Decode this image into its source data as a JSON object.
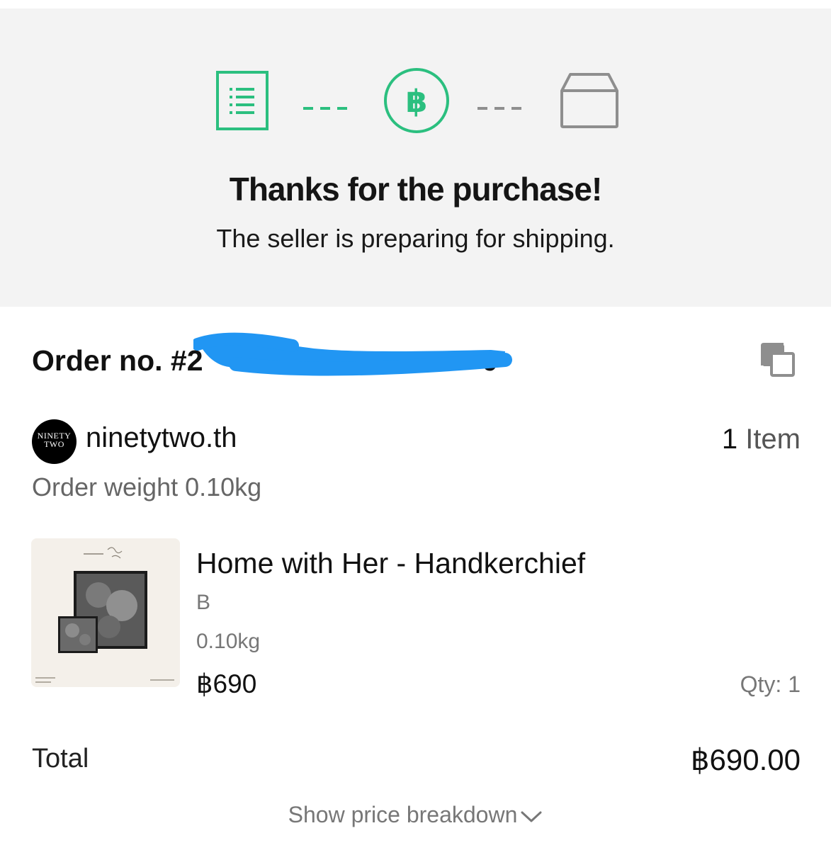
{
  "colors": {
    "accent_green": "#2bbf7f",
    "inactive_gray": "#8e8e8e",
    "hero_bg": "#f3f3f3",
    "redaction_blue": "#2196f3"
  },
  "stepper": {
    "steps": [
      {
        "name": "order-list-icon",
        "state": "completed"
      },
      {
        "name": "baht-payment-icon",
        "state": "current"
      },
      {
        "name": "box-shipping-icon",
        "state": "upcoming"
      }
    ],
    "currency_glyph": "฿"
  },
  "hero": {
    "title": "Thanks for the purchase!",
    "subtitle": "The seller is preparing for shipping."
  },
  "order": {
    "label_prefix": "Order no. #2",
    "label_suffix": "0",
    "copy_icon": "copy-icon"
  },
  "seller": {
    "logo_line1": "NINETY",
    "logo_line2": "TWO",
    "name": "ninetytwo.th",
    "item_count": "1",
    "item_unit": "Item",
    "order_weight": "Order weight 0.10kg"
  },
  "product": {
    "name": "Home with Her - Handkerchief",
    "variant": "B",
    "weight": "0.10kg",
    "price": "฿690",
    "qty": "Qty: 1"
  },
  "total": {
    "label": "Total",
    "value": "฿690.00"
  },
  "breakdown": {
    "label": "Show price breakdown"
  }
}
